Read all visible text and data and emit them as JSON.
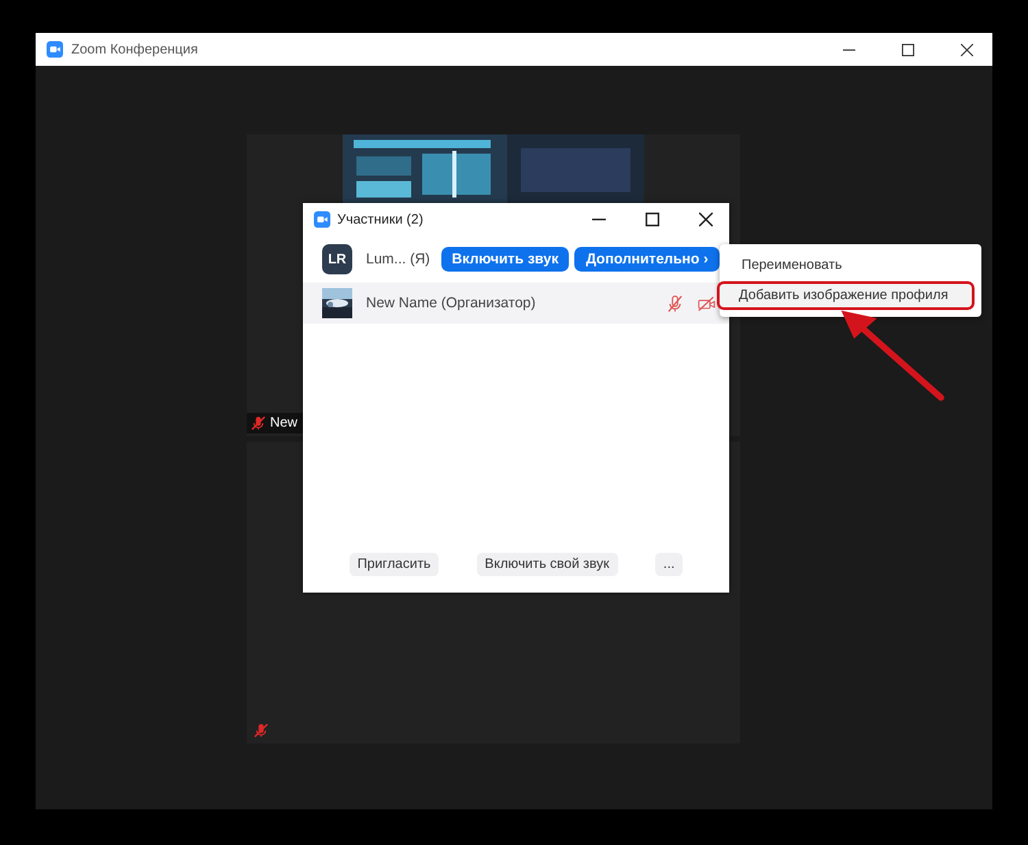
{
  "window": {
    "title": "Zoom Конференция"
  },
  "video_tiles": [
    {
      "name_label": "New",
      "muted": true,
      "kind": "picture"
    },
    {
      "muted": true,
      "kind": "empty"
    }
  ],
  "participants_panel": {
    "title": "Участники (2)",
    "participants": [
      {
        "kind": "initials",
        "initials": "LR",
        "name": "Lum... (Я)",
        "selected": false,
        "buttons": [
          "Включить звук",
          "Дополнительно ›"
        ]
      },
      {
        "kind": "picture",
        "name": "New Name (Организатор)",
        "selected": true,
        "muted": true,
        "video_off": true
      }
    ],
    "footer_buttons": [
      "Пригласить",
      "Включить свой звук",
      "..."
    ]
  },
  "context_menu": {
    "items": [
      {
        "label": "Переименовать",
        "selected": false
      },
      {
        "label": "Добавить изображение профиля",
        "selected": true
      }
    ]
  }
}
